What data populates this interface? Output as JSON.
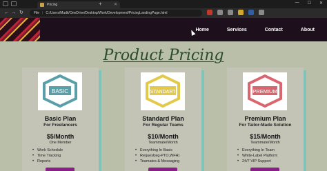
{
  "browser": {
    "tab_title": "Pricing",
    "url_label": "File",
    "url": "C:/Users/Mudit/OneDrive/Desktop/Work/Development/PricingLandingPage.html"
  },
  "nav": {
    "links": [
      "Home",
      "Services",
      "Contact",
      "About"
    ]
  },
  "page": {
    "headline": "Product Pricing"
  },
  "plans": [
    {
      "badge": "BASIC",
      "name": "Basic Plan",
      "subtitle": "For Freelancers",
      "price": "$5/Month",
      "detail": "One Member",
      "features": [
        "Work Schedule",
        "Time Tracking",
        "Reports"
      ],
      "color": "#5a9fa8"
    },
    {
      "badge": "STANDART",
      "name": "Standard Plan",
      "subtitle": "For Regular Teams",
      "price": "$10/Month",
      "detail": "Teammate/Month",
      "features": [
        "Everything In Basic",
        "Request(eg-PTO,WFH)",
        "Teamates & Messaging"
      ],
      "color": "#e3c94a"
    },
    {
      "badge": "PREMIUM",
      "name": "Premium Plan",
      "subtitle": "For Tailor-Made Solution",
      "price": "$15/Month",
      "detail": "Teammate/Month",
      "features": [
        "Everything In Team",
        "White-Label Platform",
        "24/7 VIP Support"
      ],
      "color": "#d9666e"
    }
  ]
}
